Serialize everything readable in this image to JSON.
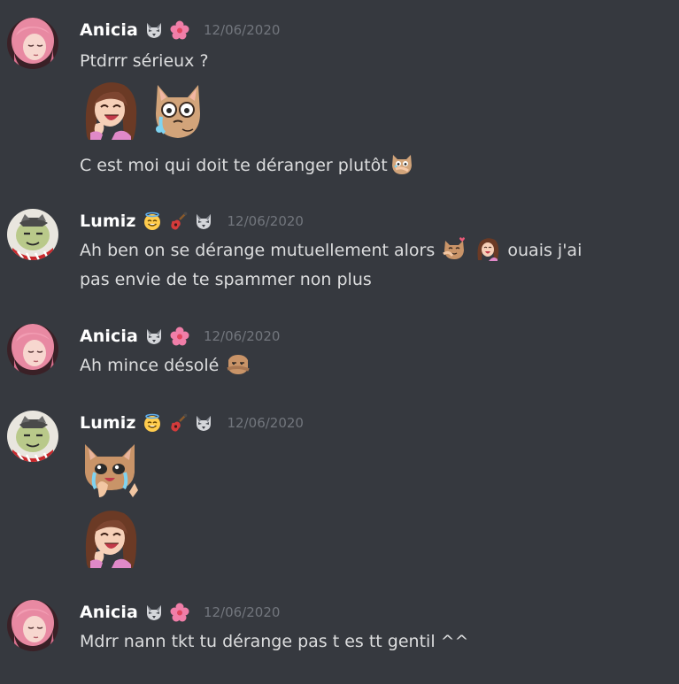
{
  "users": {
    "anicia": {
      "name": "Anicia",
      "badges": [
        "wolf-icon",
        "pink-flower-icon"
      ],
      "avatar": "pink-haired-girl-avatar"
    },
    "lumiz": {
      "name": "Lumiz",
      "badges": [
        "angel-smile-icon",
        "guitar-icon",
        "wolf-icon"
      ],
      "avatar": "green-frog-avatar"
    }
  },
  "messages": [
    {
      "author": "Anicia",
      "timestamp": "12/06/2020",
      "lines": [
        {
          "text": "Ptdrrr sérieux ?"
        },
        {
          "emotes": [
            "laughing-girl-emote",
            "crying-cat-emote"
          ]
        },
        {
          "text": "C est moi qui doit te déranger plutôt",
          "inline_emotes": [
            "shy-cat-emote"
          ]
        }
      ]
    },
    {
      "author": "Lumiz",
      "timestamp": "12/06/2020",
      "lines": [
        {
          "text_before": "Ah ben on se dérange mutuellement alors",
          "inline_emotes": [
            "love-cat-emote",
            "laughing-girl-emote"
          ],
          "text_after": "ouais j'ai"
        },
        {
          "text": "pas envie de te spammer non plus"
        }
      ]
    },
    {
      "author": "Anicia",
      "timestamp": "12/06/2020",
      "lines": [
        {
          "text": "Ah mince désolé",
          "inline_emotes": [
            "peeking-cat-emote"
          ]
        }
      ]
    },
    {
      "author": "Lumiz",
      "timestamp": "12/06/2020",
      "lines": [
        {
          "emotes": [
            "teary-cat-emote"
          ]
        },
        {
          "emotes": [
            "laughing-girl-emote"
          ]
        }
      ]
    },
    {
      "author": "Anicia",
      "timestamp": "12/06/2020",
      "lines": [
        {
          "text": "Mdrr nann tkt tu dérange pas t es tt gentil ^^"
        }
      ]
    }
  ],
  "colors": {
    "background": "#36393f",
    "username": "#ffffff",
    "message_text": "#dcddde",
    "timestamp": "#72767d"
  }
}
